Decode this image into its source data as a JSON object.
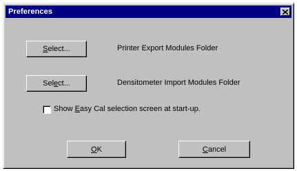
{
  "window": {
    "title": "Preferences",
    "close_icon": "close-icon"
  },
  "printer": {
    "button": {
      "pre": "",
      "ul": "S",
      "post": "elect..."
    },
    "label": "Printer Export Modules Folder"
  },
  "densitometer": {
    "button": {
      "pre": "Sel",
      "ul": "e",
      "post": "ct..."
    },
    "label": "Densitometer Import Modules Folder"
  },
  "startup_checkbox": {
    "checked": false,
    "label_pre": "Show ",
    "label_ul": "E",
    "label_post": "asy Cal selection screen at start-up."
  },
  "footer": {
    "ok": {
      "ul": "O",
      "post": "K"
    },
    "cancel": {
      "ul": "C",
      "post": "ancel"
    }
  }
}
